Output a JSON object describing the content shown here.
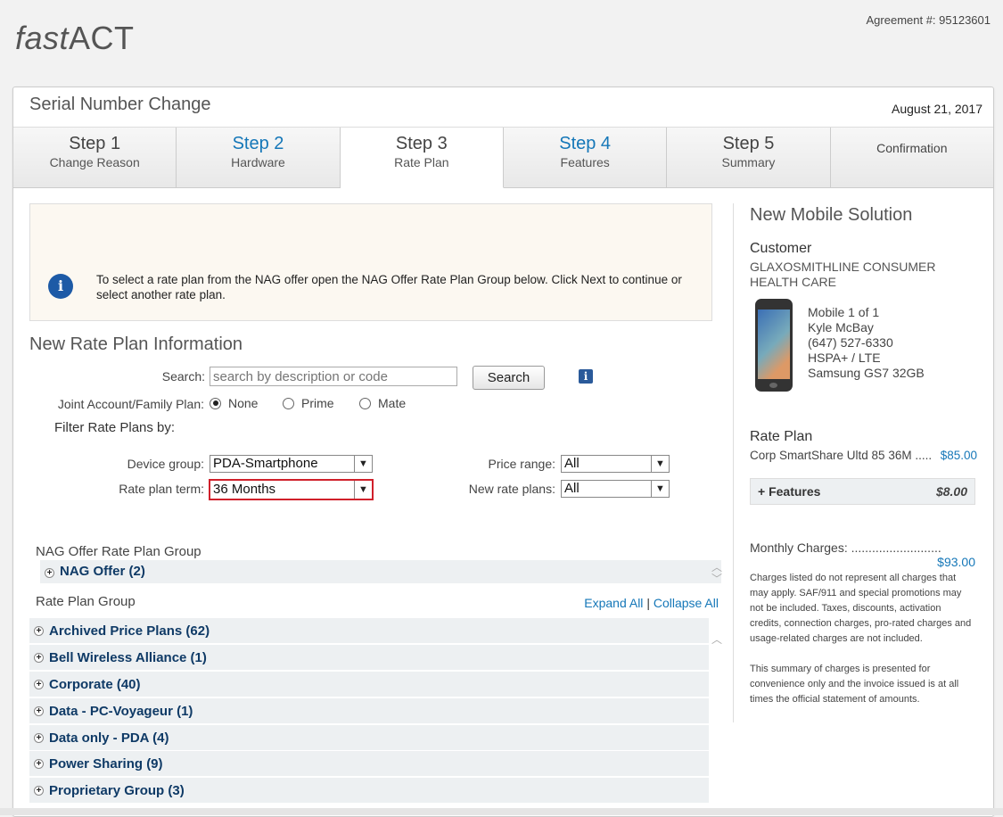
{
  "header": {
    "logo_italic": "fast",
    "logo_rest": "ACT",
    "agreement": "Agreement #: 95123601"
  },
  "page": {
    "title": "Serial Number Change",
    "date": "August 21, 2017"
  },
  "steps": [
    {
      "num": "Step 1",
      "label": "Change Reason"
    },
    {
      "num": "Step 2",
      "label": "Hardware"
    },
    {
      "num": "Step 3",
      "label": "Rate Plan"
    },
    {
      "num": "Step 4",
      "label": "Features"
    },
    {
      "num": "Step 5",
      "label": "Summary"
    },
    {
      "num": "",
      "label": "Confirmation"
    }
  ],
  "info": {
    "text": "To select a rate plan from the NAG offer open the NAG Offer Rate Plan Group below. Click Next to continue or select another rate plan."
  },
  "rate_plan_info": {
    "title": "New Rate Plan Information",
    "search_label": "Search:",
    "search_placeholder": "search by description or code",
    "search_button": "Search",
    "joint_label": "Joint Account/Family Plan:",
    "joint_options": [
      "None",
      "Prime",
      "Mate"
    ],
    "joint_selected": "None",
    "filter_title": "Filter Rate Plans by:",
    "device_group_label": "Device group:",
    "device_group_value": "PDA-Smartphone",
    "term_label": "Rate plan term:",
    "term_value": "36 Months",
    "price_range_label": "Price range:",
    "price_range_value": "All",
    "new_plans_label": "New rate plans:",
    "new_plans_value": "All"
  },
  "nag": {
    "title": "NAG Offer Rate Plan Group",
    "offer": "NAG Offer (2)"
  },
  "rate_plan_group": {
    "title": "Rate Plan Group",
    "expand_all": "Expand All",
    "separator": "|",
    "collapse_all": "Collapse All",
    "groups": [
      "Archived Price Plans (62)",
      "Bell Wireless Alliance (1)",
      "Corporate (40)",
      "Data - PC-Voyageur (1)",
      "Data only - PDA (4)",
      "Power Sharing (9)",
      "Proprietary Group (3)"
    ]
  },
  "solution": {
    "title": "New Mobile Solution",
    "customer_heading": "Customer",
    "customer_name": "GLAXOSMITHLINE CONSUMER HEALTH CARE",
    "mobile": "Mobile 1 of 1",
    "user": "Kyle McBay",
    "phone": "(647) 527-6330",
    "network": "HSPA+ / LTE",
    "device": "Samsung GS7 32GB",
    "rate_plan_heading": "Rate Plan",
    "rate_plan_name": "Corp SmartShare Ultd 85 36M",
    "rate_plan_dots": " .....",
    "rate_plan_price": "$85.00",
    "features_label": "Features",
    "features_price": "$8.00",
    "monthly_label": "Monthly Charges:",
    "monthly_dots": " ..........................",
    "monthly_value": "$93.00",
    "note1": "Charges listed do not represent all charges that may apply. SAF/911 and special promotions may not be included. Taxes, discounts, activation credits, connection charges, pro-rated charges and usage-related charges are not included.",
    "note2": "This summary of charges is presented for convenience only and the invoice issued is at all times the official statement of amounts."
  },
  "colors": {
    "link": "#1577b8",
    "group_text": "#0f3a66",
    "highlight": "#d0202b"
  }
}
